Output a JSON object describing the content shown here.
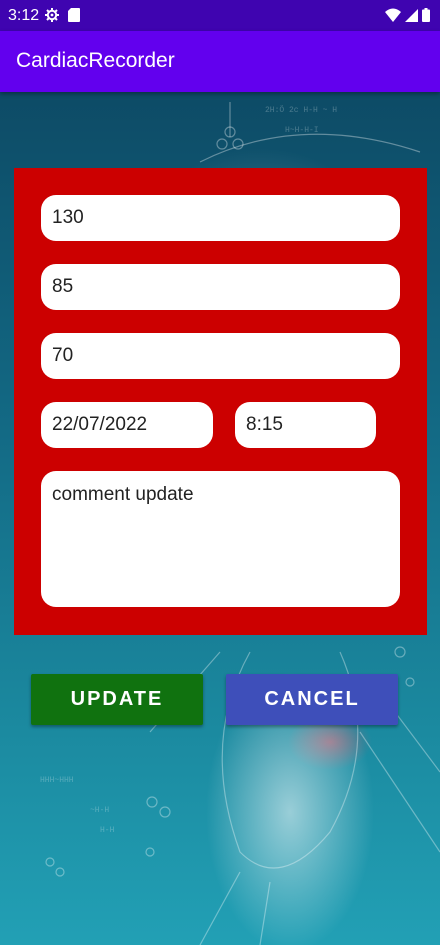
{
  "status_bar": {
    "time": "3:12",
    "left_icons": [
      "gear-icon",
      "sd-card-icon"
    ],
    "right_icons": [
      "wifi-icon",
      "signal-icon",
      "battery-icon"
    ]
  },
  "app_bar": {
    "title": "CardiacRecorder"
  },
  "form": {
    "systolic": "130",
    "diastolic": "85",
    "heart_rate": "70",
    "date": "22/07/2022",
    "time": "8:15",
    "comment": "comment update"
  },
  "buttons": {
    "update_label": "UPDATE",
    "cancel_label": "CANCEL"
  },
  "colors": {
    "status_bar": "#3f04b0",
    "app_bar": "#6200ee",
    "panel": "#cc0000",
    "update_button": "#10720f",
    "cancel_button": "#3e4fba"
  }
}
